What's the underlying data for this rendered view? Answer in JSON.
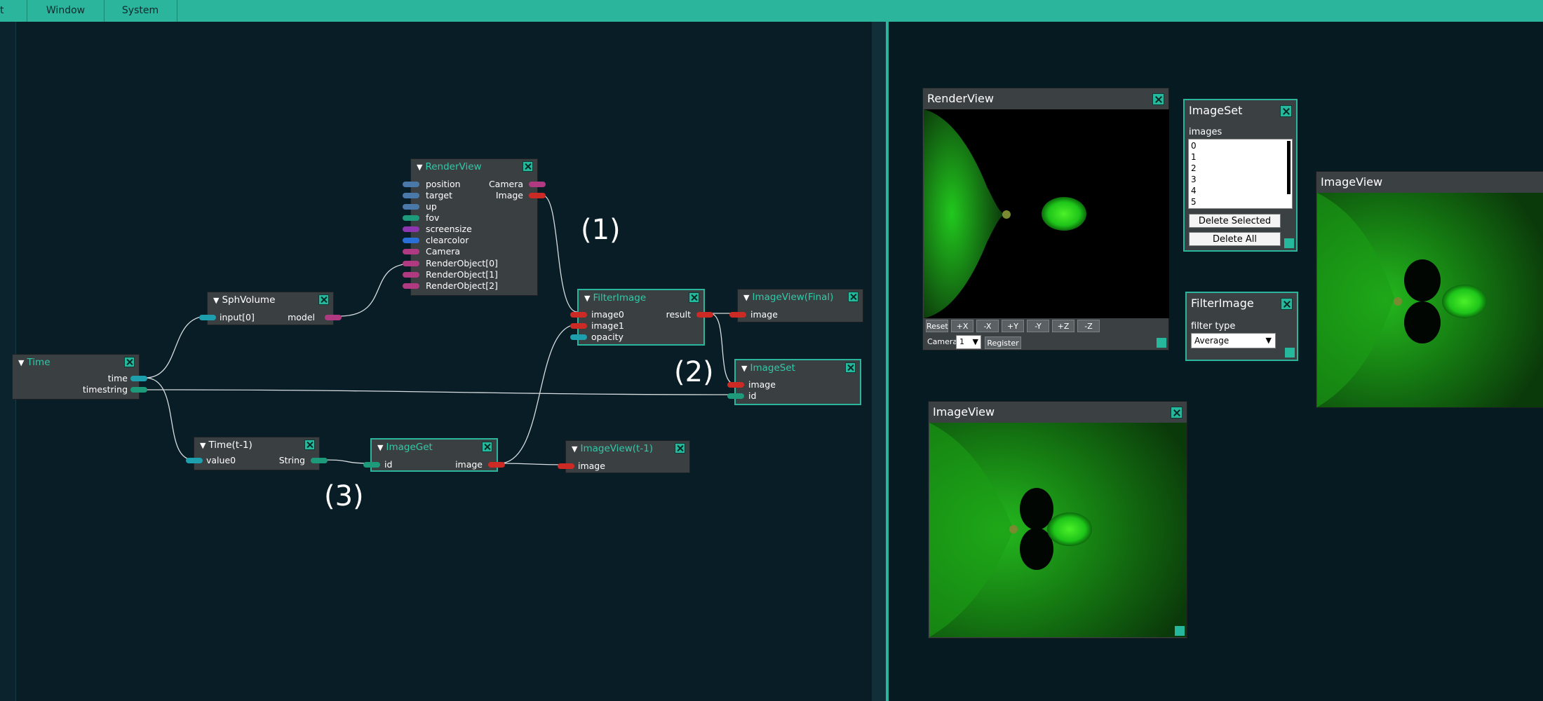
{
  "menu": [
    {
      "label": "t"
    },
    {
      "label": "Window"
    },
    {
      "label": "System"
    }
  ],
  "nodes": {
    "renderview": {
      "title": "RenderView",
      "inputs": [
        "position",
        "target",
        "up",
        "fov",
        "screensize",
        "clearcolor",
        "Camera",
        "RenderObject[0]",
        "RenderObject[1]",
        "RenderObject[2]"
      ],
      "outputs": [
        "Camera",
        "Image"
      ]
    },
    "sphvolume": {
      "title": "SphVolume",
      "input": "input[0]",
      "output": "model"
    },
    "time": {
      "title": "Time",
      "outputs": [
        "time",
        "timestring"
      ]
    },
    "timet1": {
      "title": "Time(t-1)",
      "input": "value0",
      "output": "String"
    },
    "imageget": {
      "title": "ImageGet",
      "input": "id",
      "output": "image"
    },
    "imageviewt1": {
      "title": "ImageView(t-1)",
      "input": "image"
    },
    "filterimage": {
      "title": "FilterImage",
      "inputs": [
        "image0",
        "image1",
        "opacity"
      ],
      "output": "result"
    },
    "imageviewfinal": {
      "title": "ImageView(Final)",
      "input": "image"
    },
    "imageset": {
      "title": "ImageSet",
      "inputs": [
        "image",
        "id"
      ]
    }
  },
  "annotations": [
    "(1)",
    "(2)",
    "(3)"
  ],
  "panels": {
    "renderview": {
      "title": "RenderView",
      "buttons": [
        "Reset",
        "+X",
        "-X",
        "+Y",
        "-Y",
        "+Z",
        "-Z"
      ],
      "camera_label": "Camera",
      "camera_value": "1",
      "register_label": "Register"
    },
    "imageset": {
      "title": "ImageSet",
      "images_label": "images",
      "images": [
        "0",
        "1",
        "2",
        "3",
        "4",
        "5"
      ],
      "delete_selected": "Delete Selected",
      "delete_all": "Delete All"
    },
    "filterimage": {
      "title": "FilterImage",
      "filter_label": "filter type",
      "filter_value": "Average"
    },
    "imageview_right": {
      "title": "ImageView"
    },
    "imageview_bottom": {
      "title": "ImageView"
    }
  },
  "colors": {
    "accent": "#2bb59c",
    "wire": "#d7dde0",
    "pin_red": "#cc2a24",
    "pin_magenta": "#b03a82",
    "pin_teal": "#1e9fae",
    "pin_green": "#1c9a7a",
    "render_green": "#22c81e"
  }
}
